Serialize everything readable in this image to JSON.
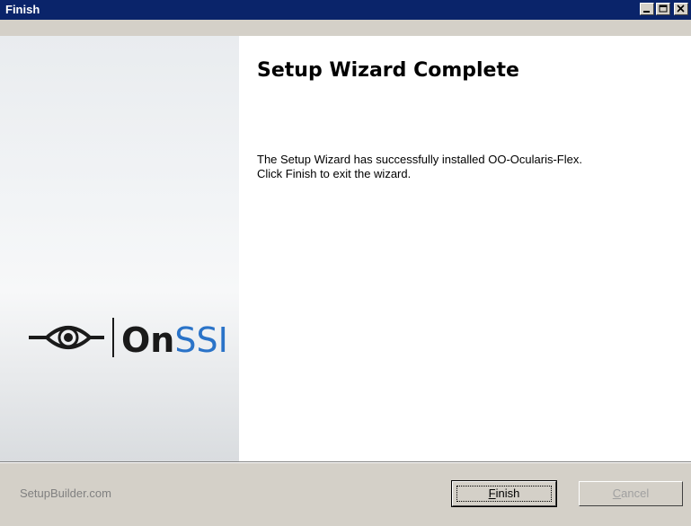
{
  "window": {
    "title": "Finish",
    "controls": [
      "minimize",
      "maximize",
      "close"
    ]
  },
  "sidebar": {
    "logo_text_prefix": "On",
    "logo_text_suffix": "SSI"
  },
  "main": {
    "heading": "Setup Wizard Complete",
    "line1": "The Setup Wizard has successfully installed OO-Ocularis-Flex.",
    "line2": "Click Finish to exit the wizard."
  },
  "footer": {
    "brand": "SetupBuilder.com",
    "finish_label": "Finish",
    "cancel_label": "Cancel"
  },
  "colors": {
    "titlebar": "#0a246a",
    "logo_accent": "#2a73c8"
  }
}
